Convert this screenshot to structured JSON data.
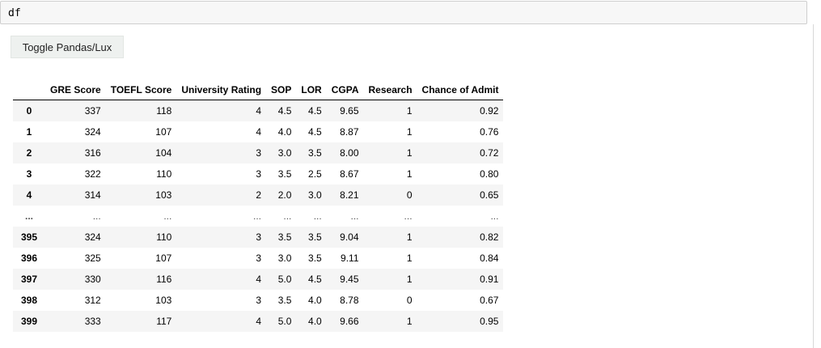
{
  "cell": {
    "code": "df"
  },
  "toggle_button": {
    "label": "Toggle Pandas/Lux"
  },
  "table": {
    "columns": [
      "GRE Score",
      "TOEFL Score",
      "University Rating",
      "SOP",
      "LOR",
      "CGPA",
      "Research",
      "Chance of Admit"
    ],
    "rows": [
      {
        "index": "0",
        "values": [
          "337",
          "118",
          "4",
          "4.5",
          "4.5",
          "9.65",
          "1",
          "0.92"
        ]
      },
      {
        "index": "1",
        "values": [
          "324",
          "107",
          "4",
          "4.0",
          "4.5",
          "8.87",
          "1",
          "0.76"
        ]
      },
      {
        "index": "2",
        "values": [
          "316",
          "104",
          "3",
          "3.0",
          "3.5",
          "8.00",
          "1",
          "0.72"
        ]
      },
      {
        "index": "3",
        "values": [
          "322",
          "110",
          "3",
          "3.5",
          "2.5",
          "8.67",
          "1",
          "0.80"
        ]
      },
      {
        "index": "4",
        "values": [
          "314",
          "103",
          "2",
          "2.0",
          "3.0",
          "8.21",
          "0",
          "0.65"
        ]
      },
      {
        "index": "...",
        "values": [
          "...",
          "...",
          "...",
          "...",
          "...",
          "...",
          "...",
          "..."
        ]
      },
      {
        "index": "395",
        "values": [
          "324",
          "110",
          "3",
          "3.5",
          "3.5",
          "9.04",
          "1",
          "0.82"
        ]
      },
      {
        "index": "396",
        "values": [
          "325",
          "107",
          "3",
          "3.0",
          "3.5",
          "9.11",
          "1",
          "0.84"
        ]
      },
      {
        "index": "397",
        "values": [
          "330",
          "116",
          "4",
          "5.0",
          "4.5",
          "9.45",
          "1",
          "0.91"
        ]
      },
      {
        "index": "398",
        "values": [
          "312",
          "103",
          "3",
          "3.5",
          "4.0",
          "8.78",
          "0",
          "0.67"
        ]
      },
      {
        "index": "399",
        "values": [
          "333",
          "117",
          "4",
          "5.0",
          "4.0",
          "9.66",
          "1",
          "0.95"
        ]
      }
    ]
  }
}
